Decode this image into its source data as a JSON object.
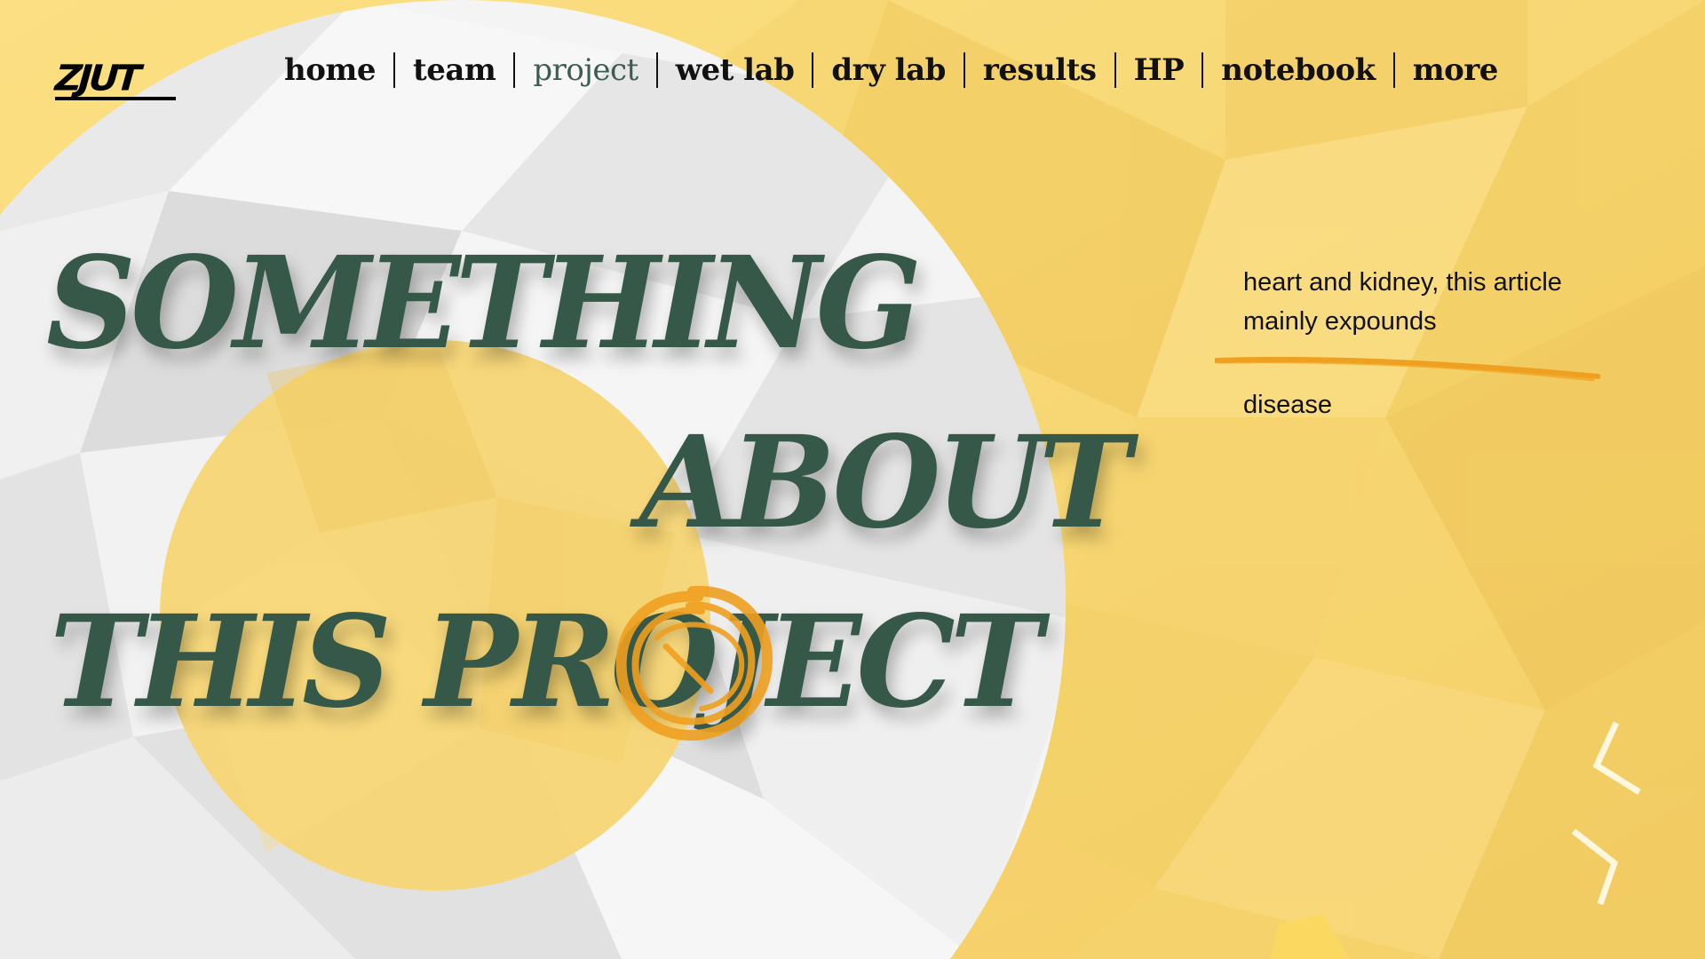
{
  "logo": {
    "text": "ZJUT"
  },
  "nav": {
    "items": [
      {
        "label": "home"
      },
      {
        "label": "team"
      },
      {
        "label": "project",
        "active": true
      },
      {
        "label": "wet lab"
      },
      {
        "label": "dry lab"
      },
      {
        "label": "results"
      },
      {
        "label": "HP"
      },
      {
        "label": "notebook"
      },
      {
        "label": "more"
      }
    ]
  },
  "hero": {
    "line1": "SOMETHING",
    "line2": "ABOUT",
    "line3": "THIS PROJECT"
  },
  "side": {
    "text": "heart and kidney, this article mainly expounds",
    "text2": "disease"
  },
  "colors": {
    "background": "#f8d877",
    "headline": "#365848",
    "nav_active": "#3d5c4f",
    "accent_orange": "#f0a020"
  },
  "icons": {
    "prev": "chevron-left-icon",
    "next": "chevron-right-icon"
  }
}
